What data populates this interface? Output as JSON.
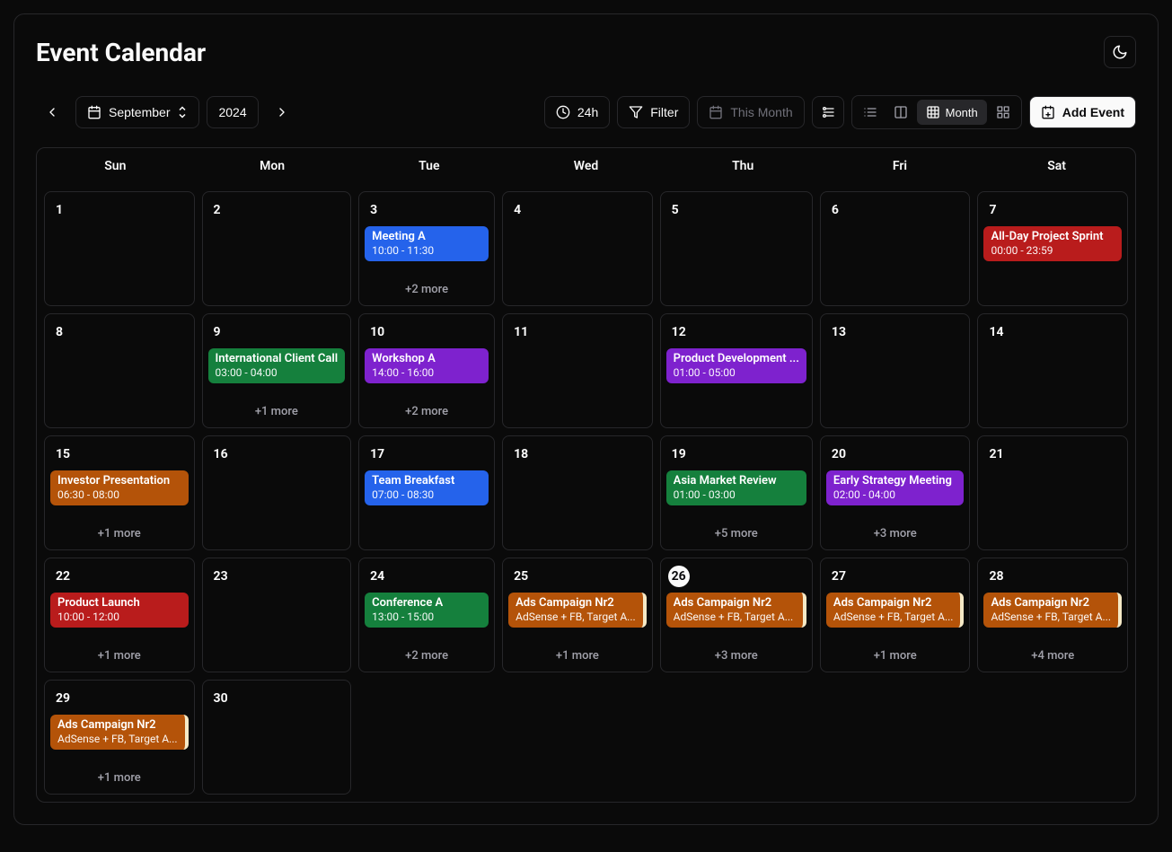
{
  "title": "Event Calendar",
  "month": "September",
  "year": "2024",
  "btn_24h": "24h",
  "btn_filter": "Filter",
  "btn_this_month": "This Month",
  "btn_month": "Month",
  "btn_add": "Add Event",
  "days": [
    "Sun",
    "Mon",
    "Tue",
    "Wed",
    "Thu",
    "Fri",
    "Sat"
  ],
  "cells": [
    {
      "date": "1"
    },
    {
      "date": "2"
    },
    {
      "date": "3",
      "event": {
        "title": "Meeting A",
        "sub": "10:00 - 11:30",
        "cls": "ev-blue"
      },
      "more": "+2 more"
    },
    {
      "date": "4"
    },
    {
      "date": "5"
    },
    {
      "date": "6"
    },
    {
      "date": "7",
      "event": {
        "title": "All-Day Project Sprint",
        "sub": "00:00 - 23:59",
        "cls": "ev-red"
      }
    },
    {
      "date": "8"
    },
    {
      "date": "9",
      "event": {
        "title": "International Client Call",
        "sub": "03:00 - 04:00",
        "cls": "ev-green"
      },
      "more": "+1 more"
    },
    {
      "date": "10",
      "event": {
        "title": "Workshop A",
        "sub": "14:00 - 16:00",
        "cls": "ev-purple"
      },
      "more": "+2 more"
    },
    {
      "date": "11"
    },
    {
      "date": "12",
      "event": {
        "title": "Product Development ...",
        "sub": "01:00 - 05:00",
        "cls": "ev-purple"
      }
    },
    {
      "date": "13"
    },
    {
      "date": "14"
    },
    {
      "date": "15",
      "event": {
        "title": "Investor Presentation",
        "sub": "06:30 - 08:00",
        "cls": "ev-amber"
      },
      "more": "+1 more"
    },
    {
      "date": "16"
    },
    {
      "date": "17",
      "event": {
        "title": "Team Breakfast",
        "sub": "07:00 - 08:30",
        "cls": "ev-blue"
      }
    },
    {
      "date": "18"
    },
    {
      "date": "19",
      "event": {
        "title": "Asia Market Review",
        "sub": "01:00 - 03:00",
        "cls": "ev-green"
      },
      "more": "+5 more"
    },
    {
      "date": "20",
      "event": {
        "title": "Early Strategy Meeting",
        "sub": "02:00 - 04:00",
        "cls": "ev-purple"
      },
      "more": "+3 more"
    },
    {
      "date": "21"
    },
    {
      "date": "22",
      "event": {
        "title": "Product Launch",
        "sub": "10:00 - 12:00",
        "cls": "ev-red"
      },
      "more": "+1 more"
    },
    {
      "date": "23"
    },
    {
      "date": "24",
      "event": {
        "title": "Conference A",
        "sub": "13:00 - 15:00",
        "cls": "ev-green"
      },
      "more": "+2 more"
    },
    {
      "date": "25",
      "event": {
        "title": "Ads Campaign Nr2",
        "sub": "AdSense + FB, Target A...",
        "cls": "ev-ads"
      },
      "more": "+1 more"
    },
    {
      "date": "26",
      "today": true,
      "event": {
        "title": "Ads Campaign Nr2",
        "sub": "AdSense + FB, Target A...",
        "cls": "ev-ads"
      },
      "more": "+3 more"
    },
    {
      "date": "27",
      "event": {
        "title": "Ads Campaign Nr2",
        "sub": "AdSense + FB, Target A...",
        "cls": "ev-ads"
      },
      "more": "+1 more"
    },
    {
      "date": "28",
      "event": {
        "title": "Ads Campaign Nr2",
        "sub": "AdSense + FB, Target A...",
        "cls": "ev-ads"
      },
      "more": "+4 more"
    },
    {
      "date": "29",
      "event": {
        "title": "Ads Campaign Nr2",
        "sub": "AdSense + FB, Target A...",
        "cls": "ev-ads"
      },
      "more": "+1 more"
    },
    {
      "date": "30"
    }
  ]
}
